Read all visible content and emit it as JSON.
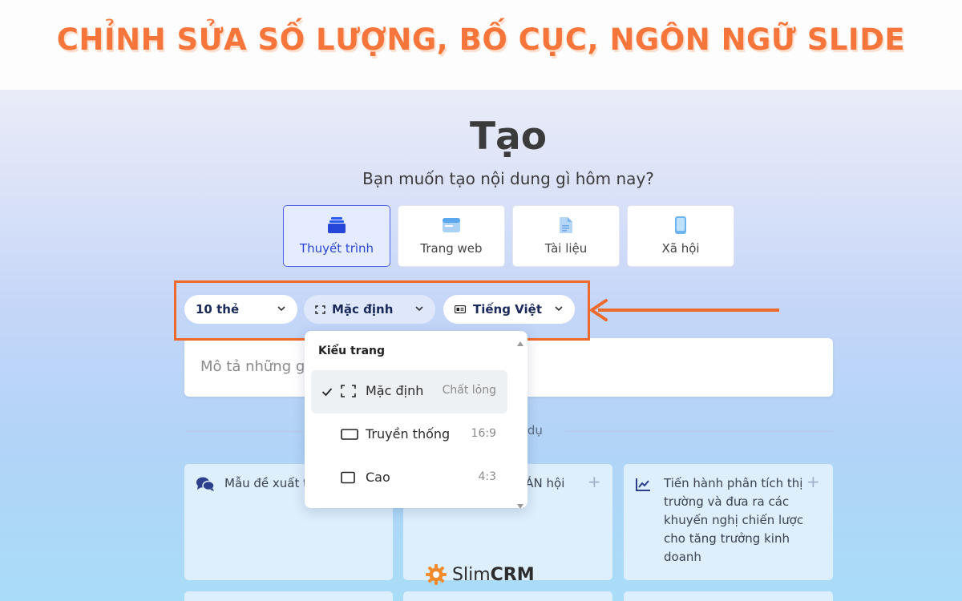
{
  "banner": {
    "title": "CHỈNH SỬA SỐ LƯỢNG, BỐ CỤC, NGÔN NGỮ SLIDE"
  },
  "header": {
    "title": "Tạo",
    "subtitle": "Bạn muốn tạo nội dung gì hôm nay?"
  },
  "content_types": [
    {
      "label": "Thuyết trình",
      "icon": "stack-icon",
      "active": true
    },
    {
      "label": "Trang web",
      "icon": "browser-icon",
      "active": false
    },
    {
      "label": "Tài liệu",
      "icon": "document-icon",
      "active": false
    },
    {
      "label": "Xã hội",
      "icon": "phone-icon",
      "active": false
    }
  ],
  "options": {
    "cards": {
      "value": "10 thẻ"
    },
    "layout": {
      "value": "Mặc định",
      "icon": "frame-icon"
    },
    "language": {
      "value": "Tiếng Việt",
      "icon": "language-icon"
    }
  },
  "prompt": {
    "placeholder": "Mô tả những gì bạn muốn tạo"
  },
  "examples": {
    "label": "ví dụ"
  },
  "layout_dropdown": {
    "header": "Kiểu trang",
    "items": [
      {
        "label": "Mặc định",
        "meta": "Chất lỏng",
        "selected": true,
        "icon": "frame-icon"
      },
      {
        "label": "Truyền thống",
        "meta": "16:9",
        "selected": false,
        "icon": "widescreen-icon"
      },
      {
        "label": "Cao",
        "meta": "4:3",
        "selected": false,
        "icon": "standard-screen-icon"
      }
    ]
  },
  "example_cards": [
    {
      "text": "Mẫu đề xuất tì",
      "icon": "chat-bubbles-icon"
    },
    {
      "text": "ư ÁN hội",
      "icon": ""
    },
    {
      "text": "Tiến hành phân tích thị trường và đưa ra các khuyến nghị chiến lược cho tăng trưởng kinh doanh",
      "icon": "line-chart-icon"
    }
  ],
  "watermark": {
    "name_light": "Slim",
    "name_bold": "CRM",
    "icon": "gear-icon"
  },
  "colors": {
    "accent_orange": "#F6753A",
    "primary_blue": "#2B47D8",
    "annotation": "#EE6A2C"
  }
}
